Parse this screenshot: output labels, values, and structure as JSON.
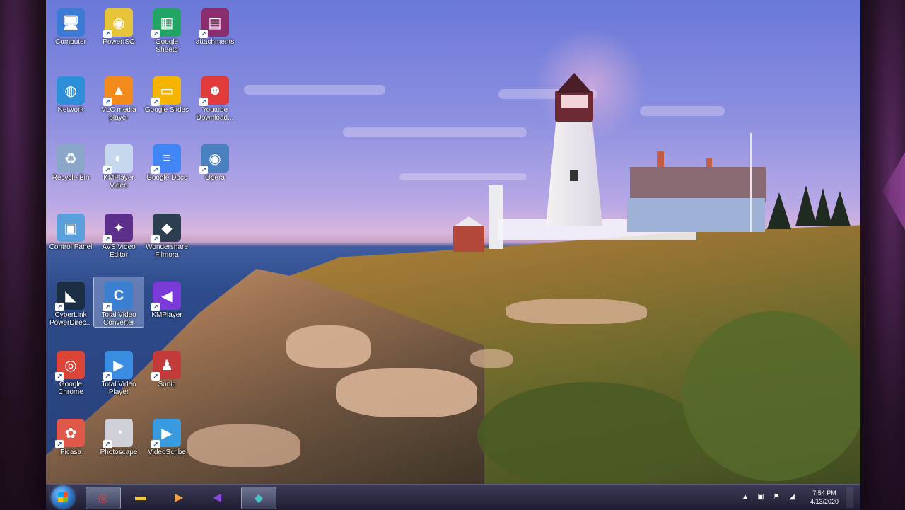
{
  "desktop": {
    "icons": [
      {
        "label": "Computer",
        "icon": "computer-icon",
        "color": "#3b7bd6",
        "glyph": "🖥"
      },
      {
        "label": "PowerISO",
        "icon": "poweriso-icon",
        "color": "#e7c33a",
        "glyph": "◉"
      },
      {
        "label": "Google Sheets",
        "icon": "google-sheets-icon",
        "color": "#21a464",
        "glyph": "▦"
      },
      {
        "label": "attachments",
        "icon": "winrar-archive-icon",
        "color": "#8a2d6e",
        "glyph": "▤"
      },
      {
        "label": "Network",
        "icon": "network-icon",
        "color": "#2d8fd8",
        "glyph": "◍"
      },
      {
        "label": "VLC media player",
        "icon": "vlc-cone-icon",
        "color": "#f28a1c",
        "glyph": "▲"
      },
      {
        "label": "Google Slides",
        "icon": "google-slides-icon",
        "color": "#f4b400",
        "glyph": "▭"
      },
      {
        "label": "Youtube Download...",
        "icon": "youtube-downloader-icon",
        "color": "#e23b3b",
        "glyph": "☻"
      },
      {
        "label": "Recycle Bin",
        "icon": "recycle-bin-icon",
        "color": "#8aa6c8",
        "glyph": "♻"
      },
      {
        "label": "KMPlayer Video",
        "icon": "kmplayer-video-icon",
        "color": "#c7d7ee",
        "glyph": "◐"
      },
      {
        "label": "Google Docs",
        "icon": "google-docs-icon",
        "color": "#4285f4",
        "glyph": "≡"
      },
      {
        "label": "Opera",
        "icon": "eye-icon",
        "color": "#4a7fc0",
        "glyph": "◉"
      },
      {
        "label": "Control Panel",
        "icon": "control-panel-icon",
        "color": "#5aa0dc",
        "glyph": "▣"
      },
      {
        "label": "AVS Video Editor",
        "icon": "avs-video-editor-icon",
        "color": "#5b2f8a",
        "glyph": "✦"
      },
      {
        "label": "Wondershare Filmora",
        "icon": "filmora-icon",
        "color": "#2c3e50",
        "glyph": "◆"
      },
      {
        "label": "CyberLink PowerDirec...",
        "icon": "powerdirector-icon",
        "color": "#1b2e44",
        "glyph": "◣"
      },
      {
        "label": "Total Video Converter",
        "icon": "video-converter-icon",
        "color": "#3b7fd0",
        "glyph": "C"
      },
      {
        "label": "KMPlayer",
        "icon": "kmplayer-icon",
        "color": "#7a3ad8",
        "glyph": "◀"
      },
      {
        "label": "Google Chrome",
        "icon": "chrome-icon",
        "color": "#db4437",
        "glyph": "◎"
      },
      {
        "label": "Total Video Player",
        "icon": "play-icon",
        "color": "#3a8de0",
        "glyph": "▶"
      },
      {
        "label": "Sonic",
        "icon": "sonic-icon",
        "color": "#c23a3a",
        "glyph": "♟"
      },
      {
        "label": "Picasa",
        "icon": "picasa-icon",
        "color": "#e0584a",
        "glyph": "✿"
      },
      {
        "label": "Photoscape",
        "icon": "photoscape-icon",
        "color": "#d0d0d8",
        "glyph": "◔"
      },
      {
        "label": "VideoScribe",
        "icon": "videoscribe-icon",
        "color": "#3a9ae0",
        "glyph": "▶"
      }
    ]
  },
  "taskbar": {
    "start_label": "Start",
    "buttons": [
      {
        "name": "taskbar-chrome-button",
        "icon": "chrome-icon",
        "glyph": "◎",
        "color": "#e8453c",
        "active": true
      },
      {
        "name": "taskbar-explorer-button",
        "icon": "folder-icon",
        "glyph": "▬",
        "color": "#f3c84a",
        "active": false
      },
      {
        "name": "taskbar-media-button",
        "icon": "media-player-icon",
        "glyph": "▶",
        "color": "#f2a03c",
        "active": false
      },
      {
        "name": "taskbar-kmplayer-button",
        "icon": "kmplayer-icon",
        "glyph": "◀",
        "color": "#8a48e0",
        "active": false
      },
      {
        "name": "taskbar-filmora-button",
        "icon": "filmora-icon",
        "glyph": "◆",
        "color": "#49c2c8",
        "active": true
      }
    ],
    "tray": {
      "icons": [
        "chevron-up-icon",
        "network-tray-icon",
        "flag-icon",
        "volume-icon"
      ],
      "time": "7:54 PM",
      "date": "4/13/2020"
    }
  }
}
